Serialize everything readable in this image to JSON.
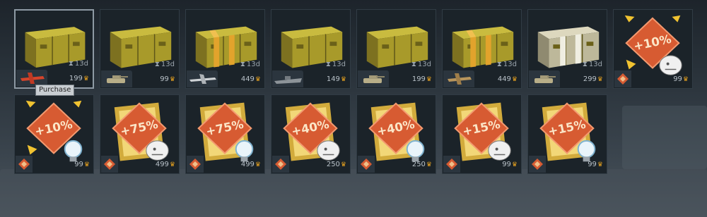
{
  "tooltip": "Purchase",
  "row1": [
    {
      "vehicle": "plane-red",
      "time": "13d",
      "price": "199",
      "variant": "plain"
    },
    {
      "vehicle": "tank",
      "time": "13d",
      "price": "99",
      "variant": "plain"
    },
    {
      "vehicle": "jet",
      "time": "13d",
      "price": "449",
      "variant": "striped"
    },
    {
      "vehicle": "ship",
      "time": "13d",
      "price": "149",
      "variant": "plain"
    },
    {
      "vehicle": "tank",
      "time": "13d",
      "price": "199",
      "variant": "plain"
    },
    {
      "vehicle": "plane-tan",
      "time": "13d",
      "price": "449",
      "variant": "striped"
    },
    {
      "vehicle": "tank",
      "time": "13d",
      "price": "299",
      "variant": "silver"
    },
    {
      "bonus": "+10%",
      "price": "99",
      "symbol": "lion",
      "arrows": true
    }
  ],
  "row2": [
    {
      "bonus": "+10%",
      "price": "99",
      "symbol": "bulb",
      "arrows": true
    },
    {
      "bonus": "+75%",
      "price": "499",
      "symbol": "lion"
    },
    {
      "bonus": "+75%",
      "price": "499",
      "symbol": "bulb"
    },
    {
      "bonus": "+40%",
      "price": "250",
      "symbol": "lion"
    },
    {
      "bonus": "+40%",
      "price": "250",
      "symbol": "bulb"
    },
    {
      "bonus": "+15%",
      "price": "99",
      "symbol": "lion"
    },
    {
      "bonus": "+15%",
      "price": "99",
      "symbol": "bulb"
    }
  ],
  "colors": {
    "crate": "#a89a2a",
    "stripe": "#e2a32c",
    "silver": "#cfc8a8",
    "diamond": "#d75b32",
    "eagle": "#e7a21f"
  }
}
